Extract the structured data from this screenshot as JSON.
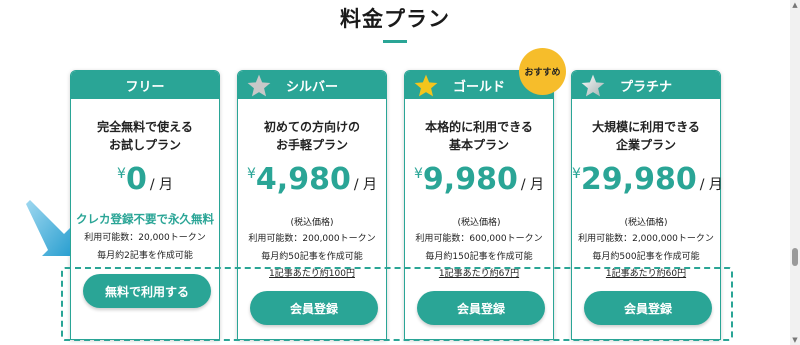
{
  "section": {
    "title": "料金プラン"
  },
  "colors": {
    "accent": "#2aa596",
    "badge": "#f6bd2b",
    "silver_star": "#c8c8c8",
    "gold_star": "#f4c51c",
    "platinum_star": "#dfe3e3"
  },
  "plans": [
    {
      "name": "フリー",
      "icon": "",
      "desc1": "完全無料で使える",
      "desc2": "お試しプラン",
      "yen": "¥",
      "price": "0",
      "unit": "/ 月",
      "highlight": "クレカ登録不要で永久無料",
      "tokens": "利用可能数：20,000トークン",
      "articles": "毎月約2記事を作成可能",
      "button": "無料で利用する"
    },
    {
      "name": "シルバー",
      "icon": "silver-star-icon",
      "desc1": "初めての方向けの",
      "desc2": "お手軽プラン",
      "yen": "¥",
      "price": "4,980",
      "unit": "/ 月",
      "tax": "(税込価格)",
      "tokens": "利用可能数：200,000トークン",
      "articles": "毎月約50記事を作成可能",
      "per_article": "1記事あたり約100円",
      "button": "会員登録"
    },
    {
      "name": "ゴールド",
      "icon": "gold-star-icon",
      "badge": "おすすめ",
      "desc1": "本格的に利用できる",
      "desc2": "基本プラン",
      "yen": "¥",
      "price": "9,980",
      "unit": "/ 月",
      "tax": "(税込価格)",
      "tokens": "利用可能数：600,000トークン",
      "articles": "毎月約150記事を作成可能",
      "per_article": "1記事あたり約67円",
      "button": "会員登録"
    },
    {
      "name": "プラチナ",
      "icon": "platinum-star-icon",
      "desc1": "大規模に利用できる",
      "desc2": "企業プラン",
      "yen": "¥",
      "price": "29,980",
      "unit": "/ 月",
      "tax": "(税込価格)",
      "tokens": "利用可能数：2,000,000トークン",
      "articles": "毎月約500記事を作成可能",
      "per_article": "1記事あたり約60円",
      "button": "会員登録"
    }
  ]
}
